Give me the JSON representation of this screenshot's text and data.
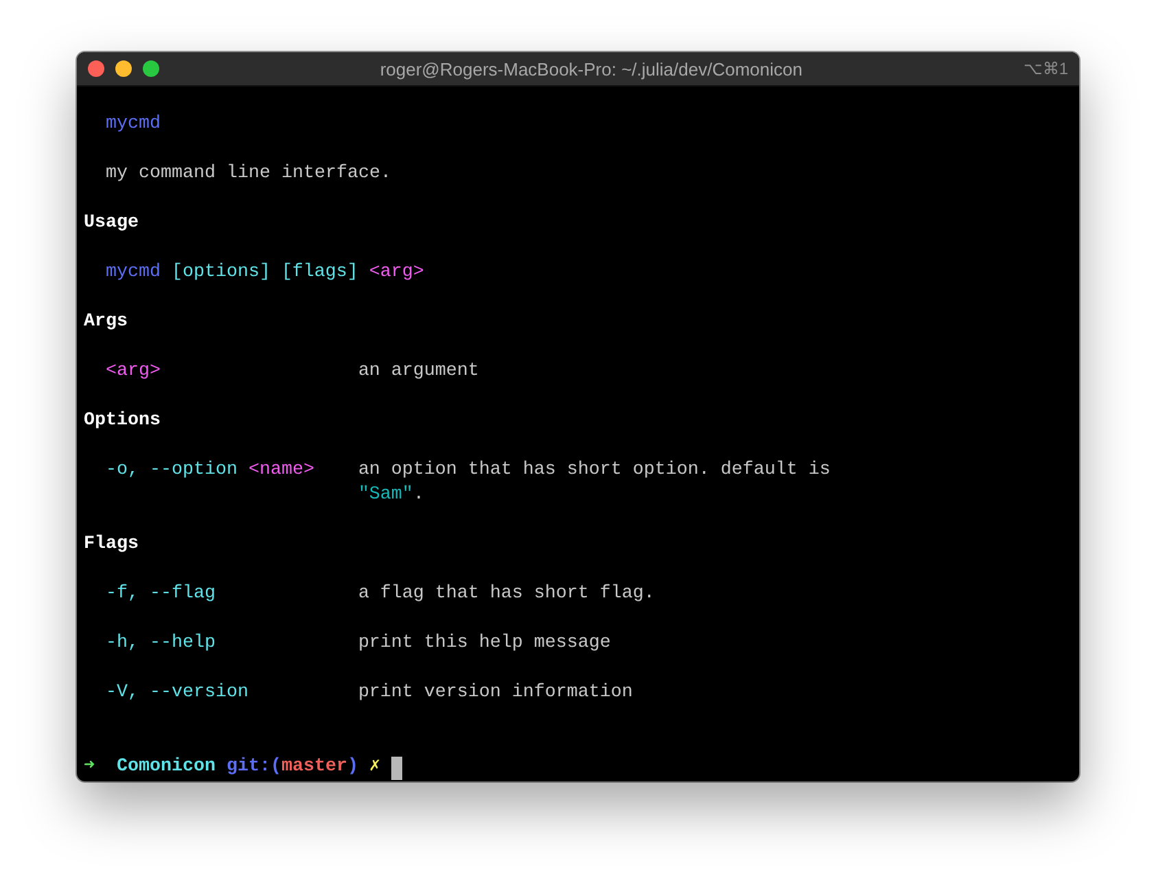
{
  "window": {
    "title": "roger@Rogers-MacBook-Pro: ~/.julia/dev/Comonicon",
    "shortcut": "⌥⌘1"
  },
  "blocks": [
    {
      "kind": "line",
      "segments": [
        {
          "kind": "command",
          "text": "mycmd"
        }
      ]
    },
    {
      "kind": "line",
      "segments": [
        {
          "kind": "text",
          "text": "my command line interface."
        }
      ]
    },
    {
      "kind": "heading",
      "text": "Usage"
    },
    {
      "kind": "line",
      "segments": [
        {
          "kind": "command",
          "text": "mycmd"
        },
        {
          "kind": "option",
          "text": "[options]"
        },
        {
          "kind": "option",
          "text": "[flags]"
        },
        {
          "kind": "arg",
          "text": "<arg>"
        }
      ]
    },
    {
      "kind": "heading",
      "text": "Args"
    },
    {
      "kind": "entry",
      "label": [
        {
          "kind": "arg",
          "text": "<arg>"
        }
      ],
      "description": [
        [
          {
            "kind": "text",
            "text": "an argument"
          }
        ]
      ]
    },
    {
      "kind": "heading",
      "text": "Options"
    },
    {
      "kind": "entry",
      "label": [
        {
          "kind": "option",
          "text": "-o, --option"
        },
        {
          "kind": "arg",
          "text": "<name>"
        }
      ],
      "description": [
        [
          {
            "kind": "text",
            "text": "an option that has short option. default is"
          }
        ],
        [
          {
            "kind": "string",
            "text": "\"Sam\""
          },
          {
            "kind": "text",
            "text": ".",
            "attached": true
          }
        ]
      ]
    },
    {
      "kind": "heading",
      "text": "Flags"
    },
    {
      "kind": "entry",
      "label": [
        {
          "kind": "option",
          "text": "-f, --flag"
        }
      ],
      "description": [
        [
          {
            "kind": "text",
            "text": "a flag that has short flag."
          }
        ]
      ]
    },
    {
      "kind": "entry",
      "label": [
        {
          "kind": "option",
          "text": "-h, --help"
        }
      ],
      "description": [
        [
          {
            "kind": "text",
            "text": "print this help message"
          }
        ]
      ]
    },
    {
      "kind": "entry",
      "label": [
        {
          "kind": "option",
          "text": "-V, --version"
        }
      ],
      "description": [
        [
          {
            "kind": "text",
            "text": "print version information"
          }
        ]
      ]
    }
  ],
  "prompt": {
    "arrow": "➜",
    "directory": "Comonicon",
    "git_label": "git:(",
    "branch": "master",
    "git_close": ")",
    "dirty_mark": "✗"
  }
}
